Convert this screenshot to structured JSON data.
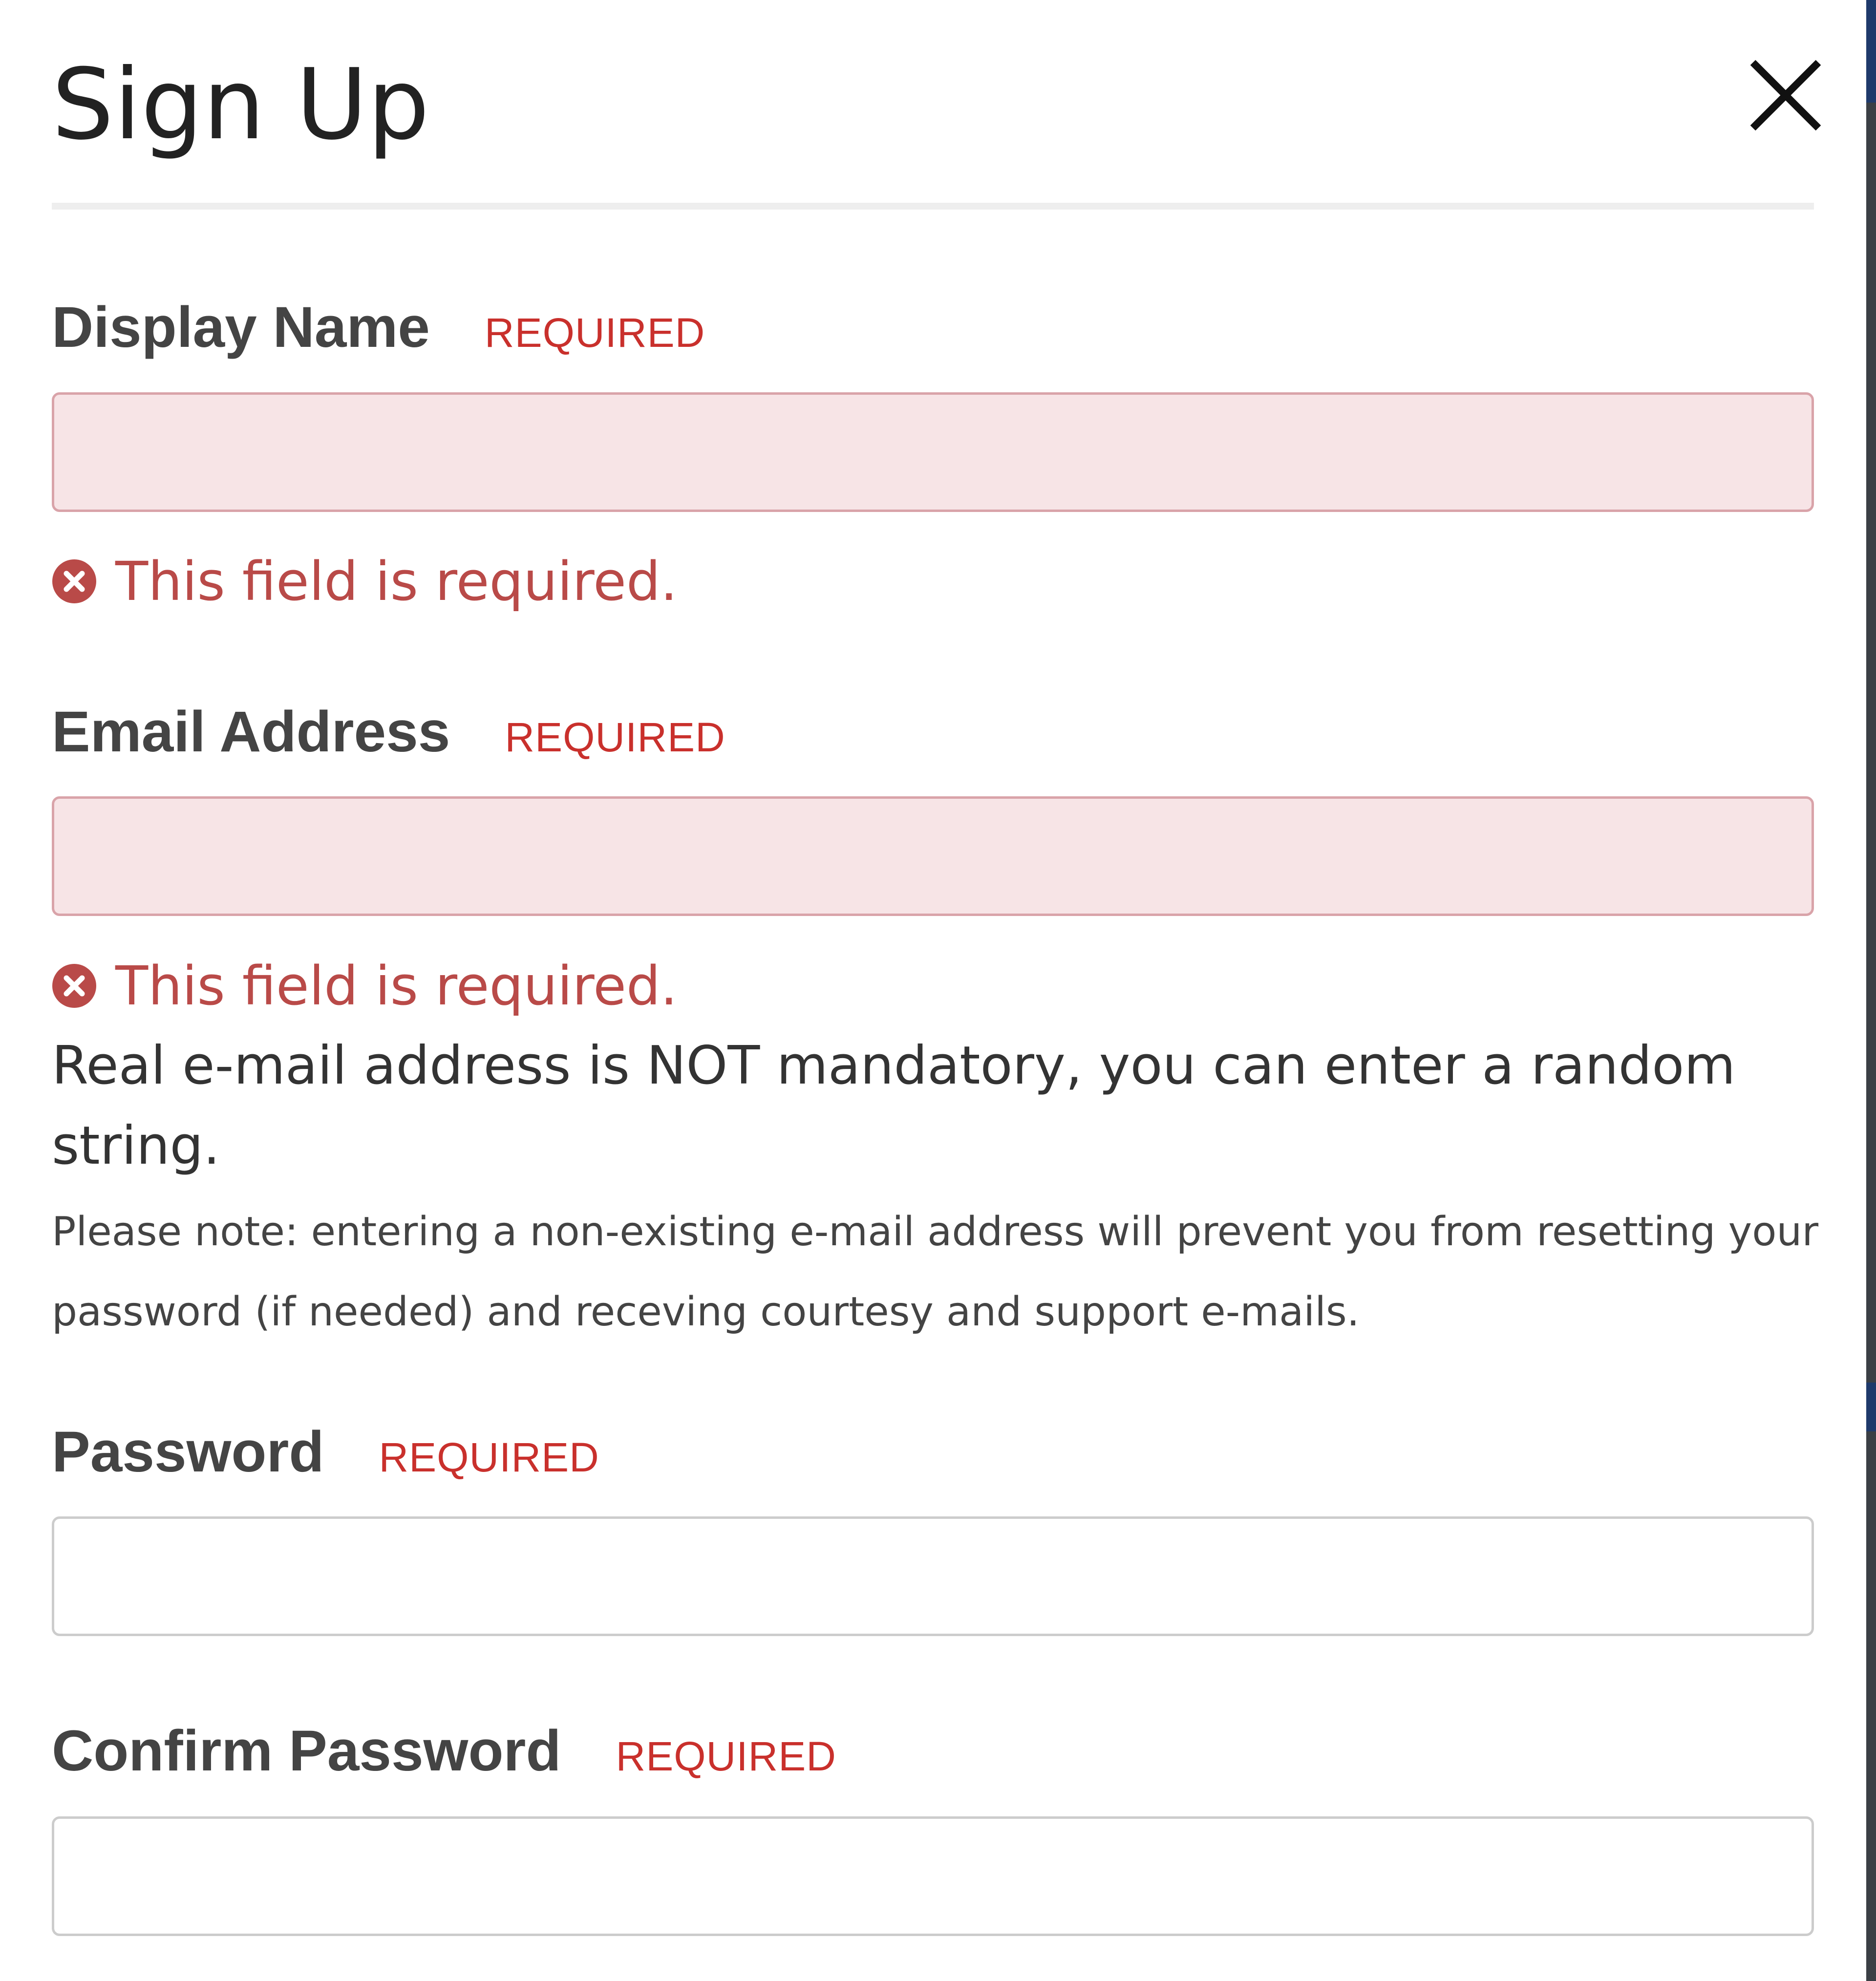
{
  "modal": {
    "title": "Sign Up",
    "close_icon": "close-icon"
  },
  "fields": {
    "display_name": {
      "label": "Display Name",
      "required": "REQUIRED",
      "value": "",
      "error": "This field is required.",
      "error_icon": "error-circle-x-icon"
    },
    "email": {
      "label": "Email Address",
      "required": "REQUIRED",
      "value": "",
      "error": "This field is required.",
      "error_icon": "error-circle-x-icon",
      "help": "Real e-mail address is NOT mandatory, you can enter a random string.",
      "note": "Please note: entering a non-existing e-mail address will prevent you from resetting your password (if needed) and receving courtesy and support e-mails."
    },
    "password": {
      "label": "Password",
      "required": "REQUIRED",
      "value": ""
    },
    "confirm_password": {
      "label": "Confirm Password",
      "required": "REQUIRED",
      "value": ""
    }
  },
  "colors": {
    "error": "#b94a48",
    "required": "#c9302c",
    "invalid_input_bg": "#f7e4e6",
    "invalid_input_border": "#d9a3a9",
    "input_border": "#cccccc"
  }
}
